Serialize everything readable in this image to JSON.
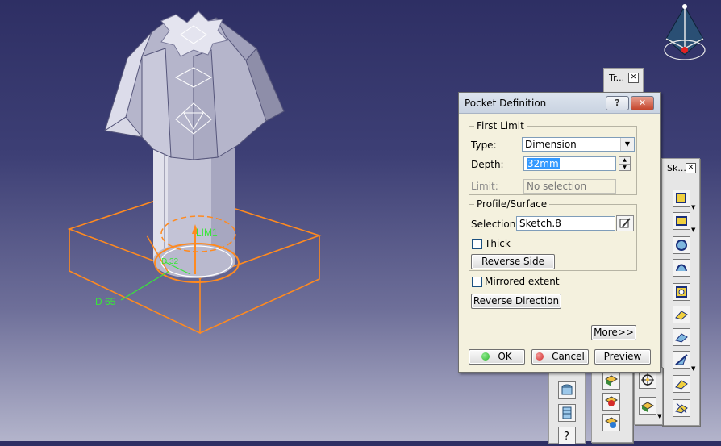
{
  "viewport": {
    "annotations": {
      "limit_label": "LIM1",
      "dimension_label": "D 65",
      "depth_label": "D 32"
    }
  },
  "toolbars": {
    "transform": {
      "title": "Tr..."
    },
    "sketch": {
      "title": "Sk..."
    },
    "close_glyph": "✕"
  },
  "dialog": {
    "title": "Pocket Definition",
    "help_glyph": "?",
    "close_glyph": "✕",
    "first_limit": {
      "legend": "First Limit",
      "type_label": "Type:",
      "type_value": "Dimension",
      "depth_label": "Depth:",
      "depth_value": "32mm",
      "limit_label": "Limit:",
      "limit_value": "No selection"
    },
    "profile_surface": {
      "legend": "Profile/Surface",
      "selection_label": "Selection:",
      "selection_value": "Sketch.8",
      "thick_label": "Thick",
      "reverse_side_label": "Reverse Side"
    },
    "mirrored_extent_label": "Mirrored extent",
    "reverse_direction_label": "Reverse Direction",
    "more_label": "More>>",
    "ok_label": "OK",
    "cancel_label": "Cancel",
    "preview_label": "Preview"
  },
  "colors": {
    "wireframe": "#ff8a1f",
    "dimension": "#39e639",
    "ok_dot": "#2db52d",
    "cancel_dot": "#d42b2b"
  }
}
